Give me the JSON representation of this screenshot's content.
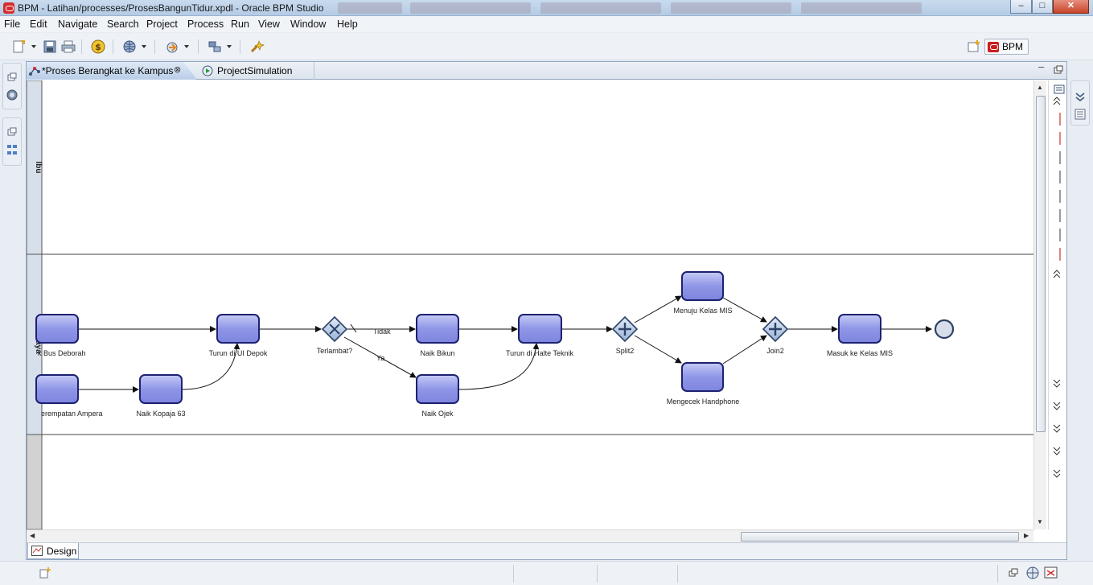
{
  "window": {
    "title": "BPM - Latihan/processes/ProsesBangunTidur.xpdl - Oracle BPM Studio",
    "controls": [
      "minimize",
      "maximize",
      "close"
    ]
  },
  "menu": [
    "File",
    "Edit",
    "Navigate",
    "Search",
    "Project",
    "Process",
    "Run",
    "View",
    "Window",
    "Help"
  ],
  "perspective": {
    "label": "BPM"
  },
  "editor": {
    "tabs": [
      {
        "label": "*Proses Berangkat ke Kampus",
        "active": true,
        "closable": true
      },
      {
        "label": "ProjectSimulation",
        "active": false
      }
    ],
    "bottom_tab": "Design"
  },
  "lanes": [
    "Ibu",
    "Saya"
  ],
  "diagram": {
    "activities": [
      "k Bus Deborah",
      "erempatan Ampera",
      "Naik Kopaja 63",
      "Turun di UI Depok",
      "Naik Bikun",
      "Naik Ojek",
      "Turun di Halte Teknik",
      "Menuju Kelas MIS",
      "Mengecek Handphone",
      "Masuk ke Kelas MIS"
    ],
    "gateways": [
      "Terlambat?",
      "Split2",
      "Join2"
    ],
    "flow_labels": [
      "Tidak",
      "Ya"
    ]
  },
  "colors": {
    "activity_fill": "#8f96e6",
    "activity_border": "#1d2170",
    "gateway_fill": "#b6c8e3",
    "lane_header": "#d7dfeb",
    "selection": "#b9cde7"
  }
}
